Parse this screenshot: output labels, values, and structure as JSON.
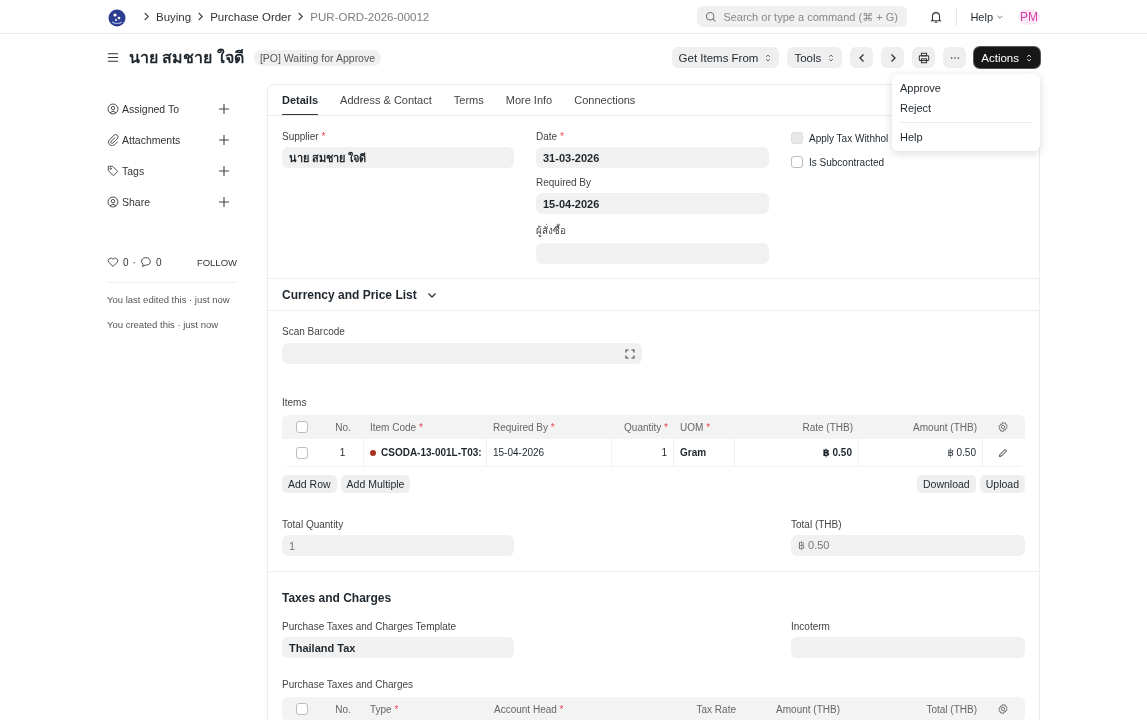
{
  "navbar": {
    "breadcrumbs": [
      {
        "label": "Buying",
        "current": false
      },
      {
        "label": "Purchase Order",
        "current": false
      },
      {
        "label": "PUR-ORD-2026-00012",
        "current": true
      }
    ],
    "search": {
      "placeholder": "Search or type a command (⌘ + G)"
    },
    "help": "Help",
    "avatar": "PM"
  },
  "page_header": {
    "title": "นาย สมชาย ใจดี",
    "status": "[PO] Waiting for Approve",
    "buttons": [
      {
        "kind": "select",
        "label": "Get Items From"
      },
      {
        "kind": "select",
        "label": "Tools"
      },
      {
        "kind": "prev"
      },
      {
        "kind": "next"
      },
      {
        "kind": "print"
      },
      {
        "kind": "more"
      },
      {
        "kind": "primary",
        "label": "Actions"
      }
    ]
  },
  "actions_menu": {
    "groups": [
      [
        {
          "label": "Approve"
        },
        {
          "label": "Reject"
        }
      ],
      [
        {
          "label": "Help"
        }
      ]
    ]
  },
  "sidebar": {
    "items": [
      {
        "kind": "user",
        "label": "Assigned To"
      },
      {
        "kind": "clip",
        "label": "Attachments"
      },
      {
        "kind": "tag",
        "label": "Tags"
      },
      {
        "kind": "user",
        "label": "Share"
      }
    ],
    "likes": "0",
    "separator": "·",
    "comments": "0",
    "follow": "FOLLOW",
    "activity": [
      "You last edited this · just now",
      "You created this · just now"
    ]
  },
  "tabs": [
    {
      "label": "Details",
      "selected": true
    },
    {
      "label": "Address & Contact",
      "selected": false
    },
    {
      "label": "Terms",
      "selected": false
    },
    {
      "label": "More Info",
      "selected": false
    },
    {
      "label": "Connections",
      "selected": false
    }
  ],
  "details": {
    "column_1": [
      {
        "label": "Supplier",
        "required_mark": "*",
        "value": "นาย สมชาย ใจดี"
      }
    ],
    "column_2": [
      {
        "label": "Date",
        "required_mark": "*",
        "value": "31-03-2026"
      },
      {
        "label": "Required By",
        "value": "15-04-2026"
      },
      {
        "label": "ผู้สั่งซื้อ"
      }
    ],
    "checkboxes": [
      {
        "label": "Apply Tax Withhol",
        "checked": false,
        "disabled": true
      },
      {
        "label": "Is Subcontracted",
        "checked": false,
        "disabled": false
      }
    ]
  },
  "currency_section": {
    "title": "Currency and Price List",
    "expanded": false
  },
  "scan_barcode": {
    "label": "Scan Barcode"
  },
  "items_table": {
    "label": "Items",
    "all_selected": false,
    "columns": [
      {
        "label": "No."
      },
      {
        "label": "Item Code",
        "required_mark": "*"
      },
      {
        "label": "Required By",
        "required_mark": "*"
      },
      {
        "label": "Quantity",
        "required_mark": "*"
      },
      {
        "label": "UOM",
        "required_mark": "*"
      },
      {
        "label": "Rate (THB)"
      },
      {
        "label": "Amount (THB)"
      }
    ],
    "rows": [
      {
        "selected": false,
        "color": "#a8321e",
        "cells": [
          "1",
          "CSODA-13-001L-T03:",
          "15-04-2026",
          "1",
          "Gram",
          "฿ 0.50",
          "฿ 0.50"
        ]
      }
    ],
    "buttons_left": [
      "Add Row",
      "Add Multiple"
    ],
    "buttons_right": [
      "Download",
      "Upload"
    ]
  },
  "totals": [
    {
      "label": "Total Quantity",
      "value": "1",
      "read_only": true
    },
    {
      "label": "Total (THB)",
      "value": "฿ 0.50",
      "read_only": true
    }
  ],
  "taxes_section": {
    "title": "Taxes and Charges",
    "template": {
      "label": "Purchase Taxes and Charges Template",
      "value": "Thailand Tax"
    },
    "incoterm": {
      "label": "Incoterm"
    },
    "table": {
      "label": "Purchase Taxes and Charges",
      "all_selected": false,
      "columns": [
        {
          "label": "No."
        },
        {
          "label": "Type",
          "required_mark": "*"
        },
        {
          "label": "Account Head",
          "required_mark": "*"
        },
        {
          "label": "Tax Rate"
        },
        {
          "label": "Amount (THB)"
        },
        {
          "label": "Total (THB)"
        }
      ]
    }
  }
}
